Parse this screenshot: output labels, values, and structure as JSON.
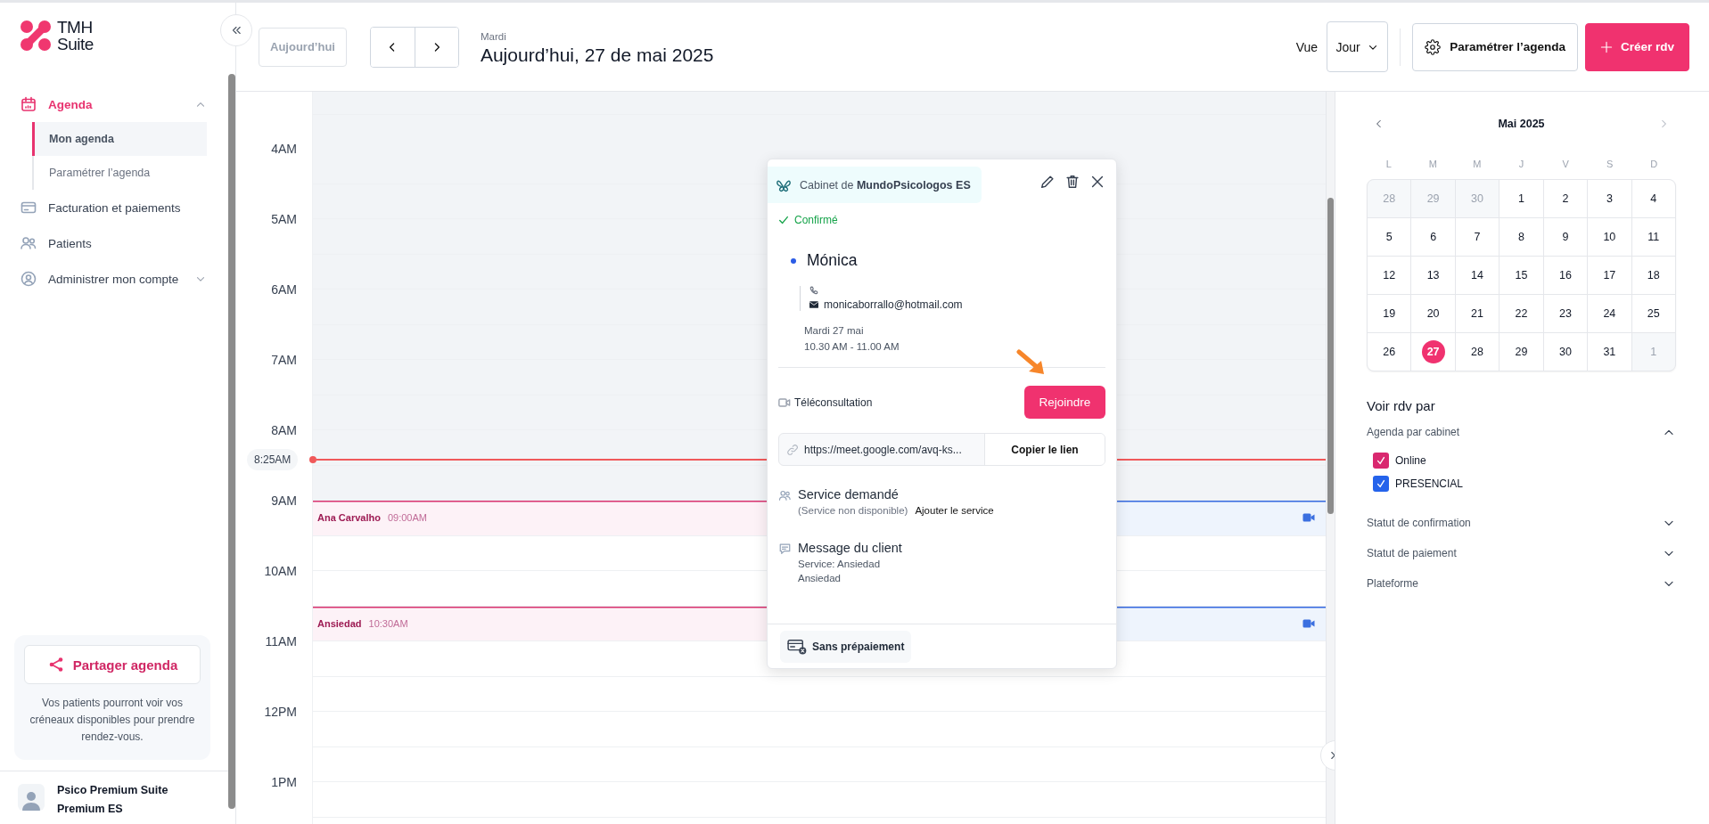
{
  "sidebar": {
    "logo": {
      "line1": "TMH",
      "line2": "Suite"
    },
    "nav": [
      {
        "label": "Agenda",
        "kind": "group",
        "selected": true,
        "expanded": true,
        "children": [
          {
            "label": "Mon agenda",
            "selected": true
          },
          {
            "label": "Paramétrer l’agenda",
            "selected": false
          }
        ]
      },
      {
        "label": "Facturation et paiements",
        "kind": "link",
        "selected": false
      },
      {
        "label": "Patients",
        "kind": "link",
        "selected": false
      },
      {
        "label": "Administrer mon compte",
        "kind": "group",
        "selected": false,
        "expanded": false
      }
    ],
    "share": {
      "button": "Partager agenda",
      "text": "Vos patients pourront voir vos créneaux disponibles pour prendre rendez-vous."
    },
    "user": {
      "name": "Psico Premium Suite",
      "plan": "Premium ES"
    }
  },
  "header": {
    "today_button": {
      "label": "Aujourd’hui",
      "disabled": true
    },
    "day": "Mardi",
    "title": "Aujourd’hui, 27 de mai 2025",
    "view_label": "Vue",
    "view_select": "Jour",
    "settings_button": "Paramétrer l’agenda",
    "create_button": "Créer rdv"
  },
  "calendar": {
    "hours": [
      {
        "label": "4AM",
        "past": true
      },
      {
        "label": "5AM",
        "past": true
      },
      {
        "label": "6AM",
        "past": true
      },
      {
        "label": "7AM",
        "past": true
      },
      {
        "label": "8AM",
        "past": true,
        "now": "8:25AM"
      },
      {
        "label": "9AM",
        "past": false,
        "first_half": {
          "title": "Ana Carvalho",
          "time": "09:00AM"
        }
      },
      {
        "label": "10AM",
        "past": false,
        "second_half": {
          "title": "Ansiedad",
          "time": "10:30AM"
        }
      },
      {
        "label": "11AM",
        "past": false
      },
      {
        "label": "12PM",
        "past": false
      },
      {
        "label": "1PM",
        "past": false
      }
    ]
  },
  "popup": {
    "cabinet": "Cabinet de **MundoPsicologos ES**",
    "status": "Confirmé",
    "client": {
      "name": "Mónica",
      "email": "monicaborrallo@hotmail.com"
    },
    "date": "Mardi 27 mai",
    "time": "10.30 AM - 11.00 AM",
    "mode": "Téléconsultation",
    "join_button": "Rejoindre",
    "link": "https://meet.google.com/avq-ks...",
    "copy_button": "Copier le lien",
    "service": {
      "title": "Service demandé",
      "note": "(Service non disponible)",
      "action": "Ajouter le service"
    },
    "message": {
      "title": "Message du client",
      "lines": [
        "Service: Ansiedad",
        "Ansiedad"
      ]
    },
    "payment": "Sans prépaiement"
  },
  "mini_calendar": {
    "month": "Mai 2025",
    "weekdays": [
      "L",
      "M",
      "M",
      "J",
      "V",
      "S",
      "D"
    ],
    "weeks": [
      [
        {
          "day": "28",
          "outside": true,
          "selected": false
        },
        {
          "day": "29",
          "outside": true,
          "selected": false
        },
        {
          "day": "30",
          "outside": true,
          "selected": false
        },
        {
          "day": "1",
          "outside": false,
          "selected": false
        },
        {
          "day": "2",
          "outside": false,
          "selected": false
        },
        {
          "day": "3",
          "outside": false,
          "selected": false
        },
        {
          "day": "4",
          "outside": false,
          "selected": false
        }
      ],
      [
        {
          "day": "5",
          "outside": false,
          "selected": false
        },
        {
          "day": "6",
          "outside": false,
          "selected": false
        },
        {
          "day": "7",
          "outside": false,
          "selected": false
        },
        {
          "day": "8",
          "outside": false,
          "selected": false
        },
        {
          "day": "9",
          "outside": false,
          "selected": false
        },
        {
          "day": "10",
          "outside": false,
          "selected": false
        },
        {
          "day": "11",
          "outside": false,
          "selected": false
        }
      ],
      [
        {
          "day": "12",
          "outside": false,
          "selected": false
        },
        {
          "day": "13",
          "outside": false,
          "selected": false
        },
        {
          "day": "14",
          "outside": false,
          "selected": false
        },
        {
          "day": "15",
          "outside": false,
          "selected": false
        },
        {
          "day": "16",
          "outside": false,
          "selected": false
        },
        {
          "day": "17",
          "outside": false,
          "selected": false
        },
        {
          "day": "18",
          "outside": false,
          "selected": false
        }
      ],
      [
        {
          "day": "19",
          "outside": false,
          "selected": false
        },
        {
          "day": "20",
          "outside": false,
          "selected": false
        },
        {
          "day": "21",
          "outside": false,
          "selected": false
        },
        {
          "day": "22",
          "outside": false,
          "selected": false
        },
        {
          "day": "23",
          "outside": false,
          "selected": false
        },
        {
          "day": "24",
          "outside": false,
          "selected": false
        },
        {
          "day": "25",
          "outside": false,
          "selected": false
        }
      ],
      [
        {
          "day": "26",
          "outside": false,
          "selected": false
        },
        {
          "day": "27",
          "outside": false,
          "selected": true
        },
        {
          "day": "28",
          "outside": false,
          "selected": false
        },
        {
          "day": "29",
          "outside": false,
          "selected": false
        },
        {
          "day": "30",
          "outside": false,
          "selected": false
        },
        {
          "day": "31",
          "outside": false,
          "selected": false
        },
        {
          "day": "1",
          "outside": true,
          "selected": false
        }
      ]
    ]
  },
  "filters": {
    "title": "Voir rdv par",
    "sections": [
      {
        "label": "Agenda par cabinet",
        "expanded": true,
        "options": [
          {
            "label": "Online",
            "checked": true,
            "color": "#d9286f"
          },
          {
            "label": "PRESENCIAL",
            "checked": true,
            "color": "#2563eb"
          }
        ]
      },
      {
        "label": "Statut de confirmation",
        "expanded": false
      },
      {
        "label": "Statut de paiement",
        "expanded": false
      },
      {
        "label": "Plateforme",
        "expanded": false
      }
    ]
  }
}
